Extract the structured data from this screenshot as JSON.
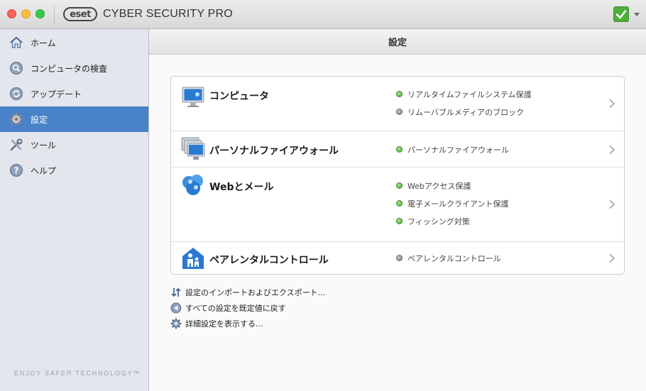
{
  "app": {
    "logo_text": "eset",
    "title": "CYBER SECURITY PRO"
  },
  "sidebar": {
    "items": [
      {
        "label": "ホーム",
        "icon": "home-icon"
      },
      {
        "label": "コンピュータの検査",
        "icon": "scan-icon"
      },
      {
        "label": "アップデート",
        "icon": "update-icon"
      },
      {
        "label": "設定",
        "icon": "gear-icon",
        "active": true
      },
      {
        "label": "ツール",
        "icon": "tools-icon"
      },
      {
        "label": "ヘルプ",
        "icon": "help-icon"
      }
    ],
    "tagline": "ENJOY SAFER TECHNOLOGY™"
  },
  "main": {
    "title": "設定",
    "sections": [
      {
        "title": "コンピュータ",
        "icon": "computer-icon",
        "statuses": [
          {
            "text": "リアルタイムファイルシステム保護",
            "state": "green"
          },
          {
            "text": "リムーバブルメディアのブロック",
            "state": "gray"
          }
        ]
      },
      {
        "title": "パーソナルファイアウォール",
        "icon": "firewall-icon",
        "statuses": [
          {
            "text": "パーソナルファイアウォール",
            "state": "green"
          }
        ]
      },
      {
        "title": "Webとメール",
        "icon": "web-mail-icon",
        "statuses": [
          {
            "text": "Webアクセス保護",
            "state": "green"
          },
          {
            "text": "電子メールクライアント保護",
            "state": "green"
          },
          {
            "text": "フィッシング対策",
            "state": "green"
          }
        ]
      },
      {
        "title": "ペアレンタルコントロール",
        "icon": "parental-control-icon",
        "statuses": [
          {
            "text": "ペアレンタルコントロール",
            "state": "gray"
          }
        ]
      }
    ],
    "actions": [
      {
        "label": "設定のインポートおよびエクスポート...",
        "icon": "import-export-icon"
      },
      {
        "label": "すべての設定を既定値に戻す",
        "icon": "revert-icon"
      },
      {
        "label": "詳細設定を表示する...",
        "icon": "advanced-gear-icon"
      }
    ]
  },
  "colors": {
    "accent": "#4a82c8",
    "status_green": "#4ea43a",
    "status_gray": "#7b7b7b"
  }
}
